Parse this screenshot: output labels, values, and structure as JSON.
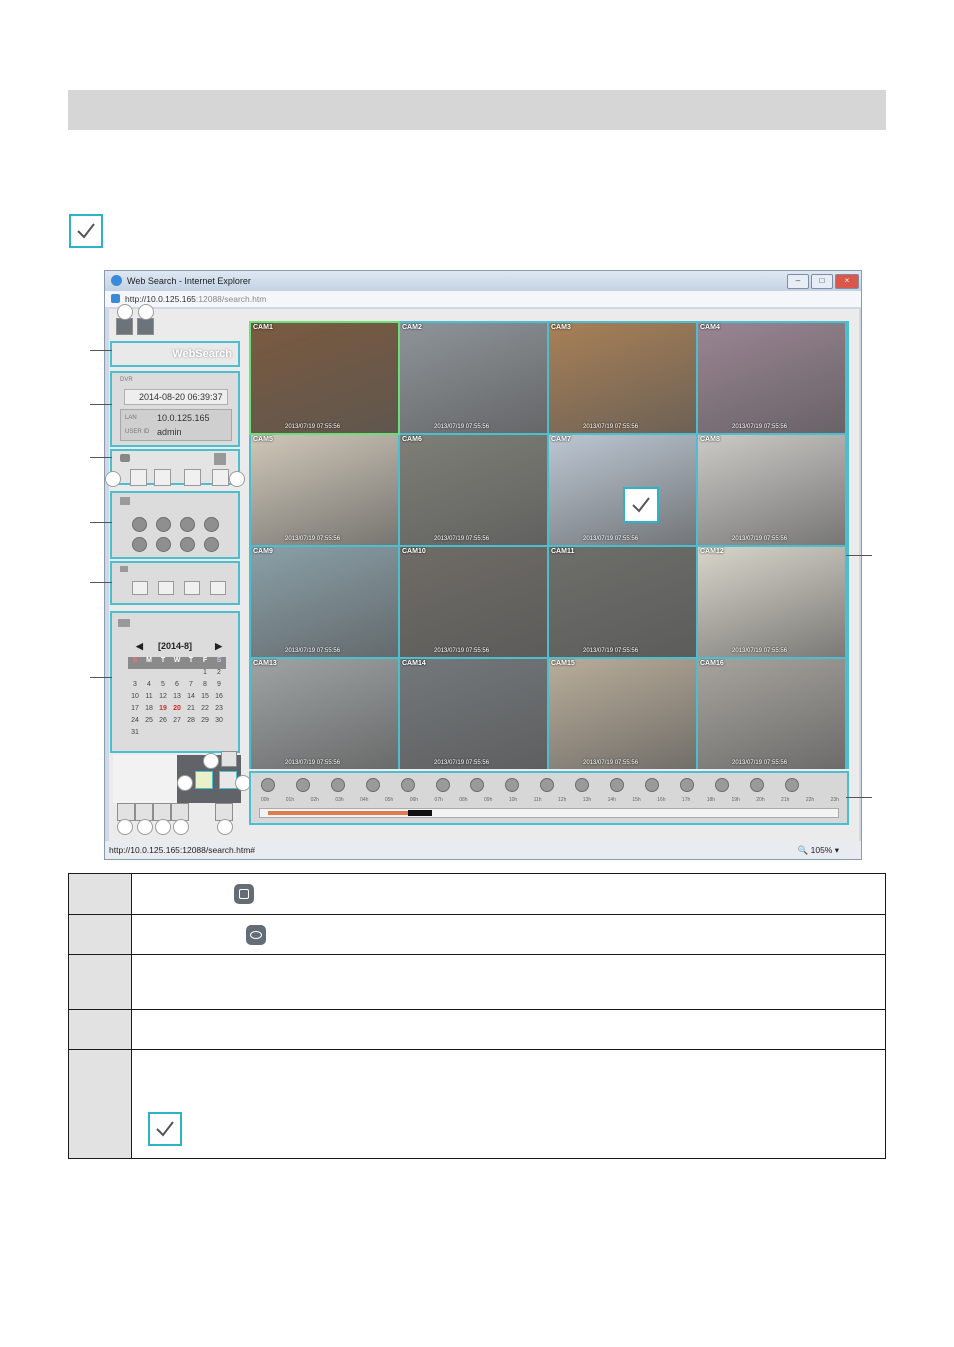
{
  "window": {
    "title": "Web Search - Internet Explorer",
    "address_host": "http://10.0.125.165",
    "address_rest": ":12088/search.htm",
    "status_url": "http://10.0.125.165:12088/search.htm#",
    "zoom": "105%"
  },
  "left_panel": {
    "logo": "WebSearch",
    "date_label": "DVR",
    "datetime": "2014-08-20 06:39:37",
    "ip_label": "LAN",
    "ip": "10.0.125.165",
    "user_label": "USER ID",
    "user": "admin"
  },
  "calendar": {
    "month_label": "[2014-8]",
    "day_headers": [
      "S",
      "M",
      "T",
      "W",
      "T",
      "F",
      "S"
    ],
    "weeks": [
      [
        "",
        "",
        "",
        "",
        "",
        "1",
        "2"
      ],
      [
        "3",
        "4",
        "5",
        "6",
        "7",
        "8",
        "9"
      ],
      [
        "10",
        "11",
        "12",
        "13",
        "14",
        "15",
        "16"
      ],
      [
        "17",
        "18",
        "19",
        "20",
        "21",
        "22",
        "23"
      ],
      [
        "24",
        "25",
        "26",
        "27",
        "28",
        "29",
        "30"
      ],
      [
        "31",
        "",
        "",
        "",
        "",
        "",
        ""
      ]
    ],
    "recorded_day": "19",
    "current_day": "20"
  },
  "cameras": [
    {
      "label": "CAM1",
      "ts": "2013/07/19 07:55:56",
      "color": "#7a5a3f"
    },
    {
      "label": "CAM2",
      "ts": "2013/07/19 07:55:56",
      "color": "#8e9499"
    },
    {
      "label": "CAM3",
      "ts": "2013/07/19 07:55:56",
      "color": "#a88056"
    },
    {
      "label": "CAM4",
      "ts": "2013/07/19 07:55:56",
      "color": "#9a8593"
    },
    {
      "label": "CAM5",
      "ts": "2013/07/19 07:55:56",
      "color": "#cfc7b8"
    },
    {
      "label": "CAM6",
      "ts": "2013/07/19 07:55:56",
      "color": "#7f7f78"
    },
    {
      "label": "CAM7",
      "ts": "2013/07/19 07:55:56",
      "color": "#bcc7d3"
    },
    {
      "label": "CAM8",
      "ts": "2013/07/19 07:55:56",
      "color": "#cbcac6"
    },
    {
      "label": "CAM9",
      "ts": "2013/07/19 07:55:56",
      "color": "#8aa0a8"
    },
    {
      "label": "CAM10",
      "ts": "2013/07/19 07:55:56",
      "color": "#6f6c66"
    },
    {
      "label": "CAM11",
      "ts": "2013/07/19 07:55:56",
      "color": "#6e6e6a"
    },
    {
      "label": "CAM12",
      "ts": "2013/07/19 07:55:56",
      "color": "#d8d5ca"
    },
    {
      "label": "CAM13",
      "ts": "2013/07/19 07:55:56",
      "color": "#9ea3a3"
    },
    {
      "label": "CAM14",
      "ts": "2013/07/19 07:55:56",
      "color": "#73787a"
    },
    {
      "label": "CAM15",
      "ts": "2013/07/19 07:55:56",
      "color": "#b9ad9a"
    },
    {
      "label": "CAM16",
      "ts": "2013/07/19 07:55:56",
      "color": "#a7a49e"
    }
  ],
  "timeline": {
    "hours": [
      "00h",
      "01h",
      "02h",
      "03h",
      "04h",
      "05h",
      "06h",
      "07h",
      "08h",
      "09h",
      "10h",
      "11h",
      "12h",
      "13h",
      "14h",
      "15h",
      "16h",
      "17h",
      "18h",
      "19h",
      "20h",
      "21h",
      "22h",
      "23h"
    ],
    "recorded_fraction": 0.27
  },
  "colors": {
    "accent": "#4bbfcf",
    "header": "#d6d6d6"
  }
}
